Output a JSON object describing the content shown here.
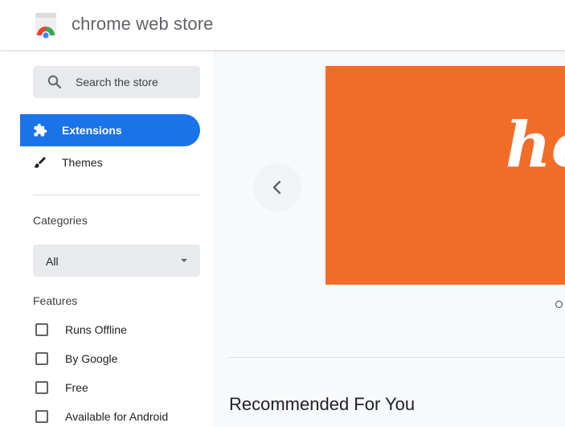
{
  "header": {
    "title": "chrome web store",
    "logo_icon": "chrome-web-store-logo"
  },
  "sidebar": {
    "search": {
      "placeholder": "Search the store",
      "icon": "search-icon"
    },
    "nav": [
      {
        "label": "Extensions",
        "icon": "puzzle-icon",
        "active": true
      },
      {
        "label": "Themes",
        "icon": "brush-icon",
        "active": false
      }
    ],
    "categories": {
      "label": "Categories",
      "selected": "All"
    },
    "features": {
      "label": "Features",
      "items": [
        {
          "label": "Runs Offline",
          "checked": false
        },
        {
          "label": "By Google",
          "checked": false
        },
        {
          "label": "Free",
          "checked": false
        },
        {
          "label": "Available for Android",
          "checked": false
        }
      ]
    }
  },
  "main": {
    "banner": {
      "text": "ho",
      "color": "#f26d28"
    },
    "carousel": {
      "prev_icon": "chevron-left-icon",
      "dots": 1
    },
    "recommended_title": "Recommended For You"
  },
  "colors": {
    "accent": "#1a73e8",
    "banner": "#f26d28",
    "sidebar_input_bg": "#e8eaed",
    "main_bg": "#f8f9fa"
  }
}
